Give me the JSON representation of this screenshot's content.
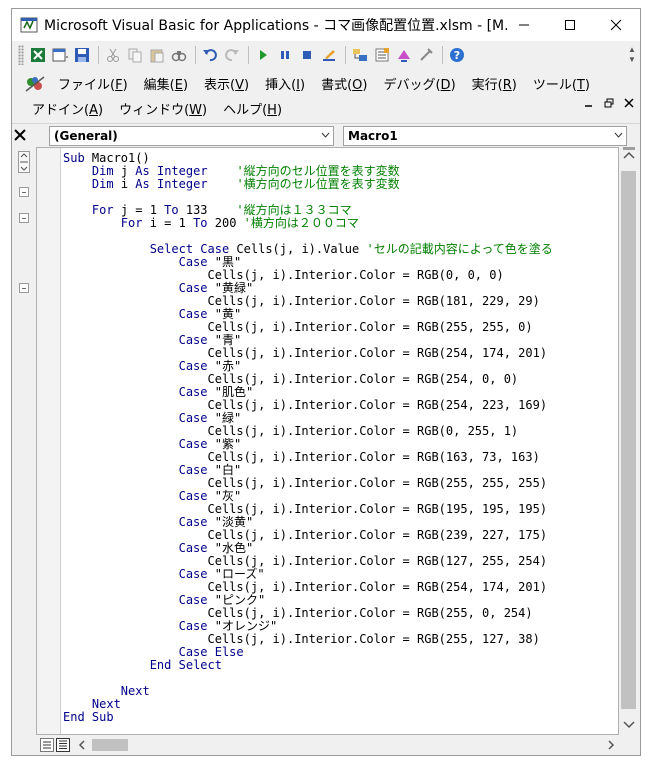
{
  "window": {
    "title": "Microsoft Visual Basic for Applications - コマ画像配置位置.xlsm - [M...",
    "controls": {
      "minimize": "minimize",
      "maximize": "maximize",
      "close": "close"
    }
  },
  "toolbar": {
    "icons": [
      "excel-icon",
      "insert-module-icon",
      "save-icon",
      "cut-icon",
      "copy-icon",
      "paste-icon",
      "find-icon",
      "undo-icon",
      "redo-icon",
      "run-icon",
      "break-icon",
      "reset-icon",
      "design-mode-icon",
      "project-explorer-icon",
      "properties-icon",
      "object-browser-icon",
      "toolbox-icon",
      "help-icon"
    ]
  },
  "menubar": {
    "row1": [
      {
        "label": "ファイル(",
        "key": "F",
        "end": ")"
      },
      {
        "label": "編集(",
        "key": "E",
        "end": ")"
      },
      {
        "label": "表示(",
        "key": "V",
        "end": ")"
      },
      {
        "label": "挿入(",
        "key": "I",
        "end": ")"
      },
      {
        "label": "書式(",
        "key": "O",
        "end": ")"
      },
      {
        "label": "デバッグ(",
        "key": "D",
        "end": ")"
      },
      {
        "label": "実行(",
        "key": "R",
        "end": ")"
      },
      {
        "label": "ツール(",
        "key": "T",
        "end": ")"
      }
    ],
    "row2": [
      {
        "label": "アドイン(",
        "key": "A",
        "end": ")"
      },
      {
        "label": "ウィンドウ(",
        "key": "W",
        "end": ")"
      },
      {
        "label": "ヘルプ(",
        "key": "H",
        "end": ")"
      }
    ]
  },
  "code_window": {
    "object_combo": "(General)",
    "procedure_combo": "Macro1",
    "lines": [
      "Sub Macro1()",
      "    Dim j As Integer    '縦方向のセル位置を表す変数",
      "    Dim i As Integer    '横方向のセル位置を表す変数",
      "",
      "    For j = 1 To 133    '縦方向は１３３コマ",
      "        For i = 1 To 200 '横方向は２００コマ",
      "",
      "            Select Case Cells(j, i).Value 'セルの記載内容によって色を塗る",
      "                Case \"黒\"",
      "                    Cells(j, i).Interior.Color = RGB(0, 0, 0)",
      "                Case \"黄緑\"",
      "                    Cells(j, i).Interior.Color = RGB(181, 229, 29)",
      "                Case \"黄\"",
      "                    Cells(j, i).Interior.Color = RGB(255, 255, 0)",
      "                Case \"青\"",
      "                    Cells(j, i).Interior.Color = RGB(254, 174, 201)",
      "                Case \"赤\"",
      "                    Cells(j, i).Interior.Color = RGB(254, 0, 0)",
      "                Case \"肌色\"",
      "                    Cells(j, i).Interior.Color = RGB(254, 223, 169)",
      "                Case \"緑\"",
      "                    Cells(j, i).Interior.Color = RGB(0, 255, 1)",
      "                Case \"紫\"",
      "                    Cells(j, i).Interior.Color = RGB(163, 73, 163)",
      "                Case \"白\"",
      "                    Cells(j, i).Interior.Color = RGB(255, 255, 255)",
      "                Case \"灰\"",
      "                    Cells(j, i).Interior.Color = RGB(195, 195, 195)",
      "                Case \"淡黄\"",
      "                    Cells(j, i).Interior.Color = RGB(239, 227, 175)",
      "                Case \"水色\"",
      "                    Cells(j, i).Interior.Color = RGB(127, 255, 254)",
      "                Case \"ローズ\"",
      "                    Cells(j, i).Interior.Color = RGB(254, 174, 201)",
      "                Case \"ピンク\"",
      "                    Cells(j, i).Interior.Color = RGB(255, 0, 254)",
      "                Case \"オレンジ\"",
      "                    Cells(j, i).Interior.Color = RGB(255, 127, 38)",
      "                Case Else",
      "            End Select",
      "",
      "        Next",
      "    Next",
      "End Sub"
    ]
  },
  "colors": {
    "keyword": "#00008b",
    "comment": "#008000",
    "text": "#000000"
  }
}
